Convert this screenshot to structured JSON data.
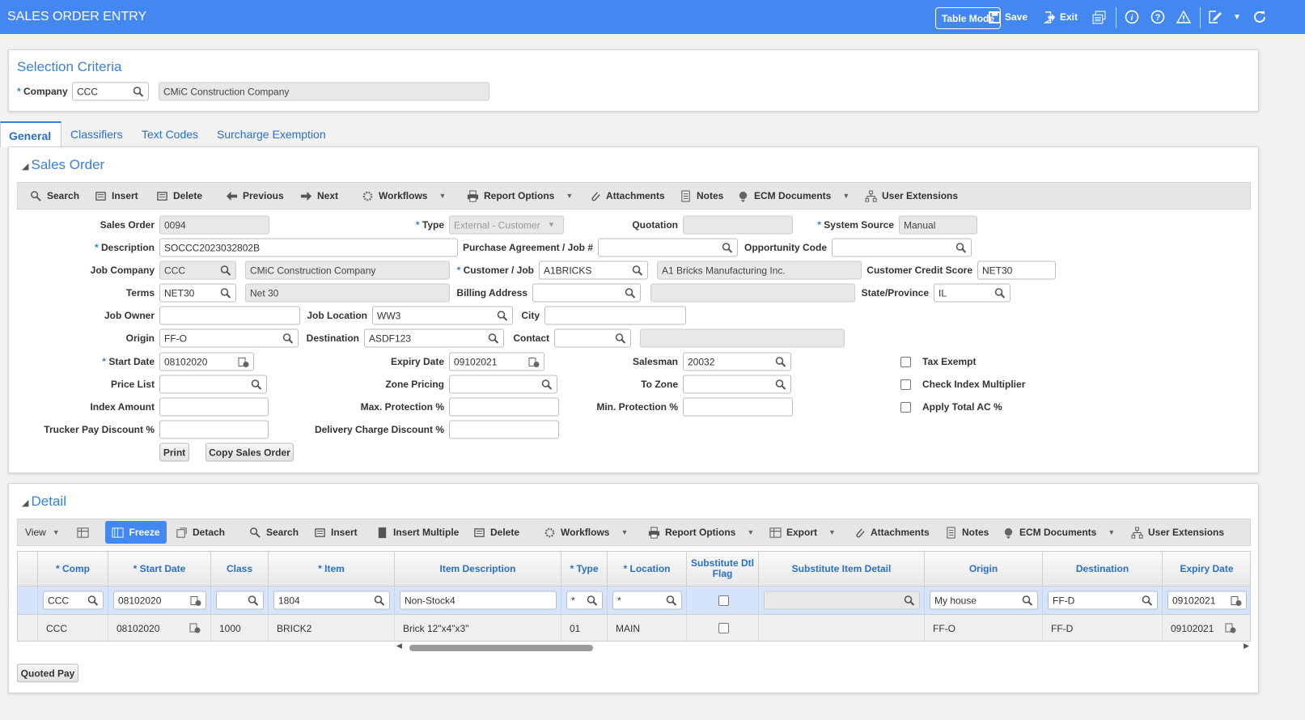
{
  "header": {
    "title": "SALES ORDER ENTRY",
    "table_mode": "Table Mode",
    "save": "Save",
    "exit": "Exit"
  },
  "selection": {
    "title": "Selection Criteria",
    "company_label": "Company",
    "company_value": "CCC",
    "company_name": "CMiC Construction Company"
  },
  "tabs": [
    "General",
    "Classifiers",
    "Text Codes",
    "Surcharge Exemption"
  ],
  "sales_order": {
    "title": "Sales Order",
    "toolbar": [
      "Search",
      "Insert",
      "Delete",
      "Previous",
      "Next",
      "Workflows",
      "Report Options",
      "Attachments",
      "Notes",
      "ECM Documents",
      "User Extensions"
    ],
    "fields": {
      "sales_order": {
        "label": "Sales Order",
        "value": "0094"
      },
      "type": {
        "label": "Type",
        "value": "External - Customer",
        "required": true
      },
      "quotation": {
        "label": "Quotation",
        "value": ""
      },
      "system_source": {
        "label": "System Source",
        "value": "Manual",
        "required": true
      },
      "description": {
        "label": "Description",
        "value": "SOCCC2023032802B",
        "required": true
      },
      "purchase_agreement": {
        "label": "Purchase Agreement / Job #",
        "value": ""
      },
      "opportunity_code": {
        "label": "Opportunity Code",
        "value": ""
      },
      "job_company": {
        "label": "Job Company",
        "value": "CCC",
        "desc": "CMiC Construction Company"
      },
      "customer_job": {
        "label": "Customer / Job",
        "value": "A1BRICKS",
        "desc": "A1 Bricks Manufacturing Inc.",
        "required": true
      },
      "customer_credit_score": {
        "label": "Customer Credit Score",
        "value": "NET30"
      },
      "terms": {
        "label": "Terms",
        "value": "NET30",
        "desc": "Net 30"
      },
      "billing_address": {
        "label": "Billing Address",
        "value": "",
        "desc": ""
      },
      "state_province": {
        "label": "State/Province",
        "value": "IL"
      },
      "job_owner": {
        "label": "Job Owner",
        "value": ""
      },
      "job_location": {
        "label": "Job Location",
        "value": "WW3"
      },
      "city": {
        "label": "City",
        "value": ""
      },
      "origin": {
        "label": "Origin",
        "value": "FF-O"
      },
      "destination": {
        "label": "Destination",
        "value": "ASDF123"
      },
      "contact": {
        "label": "Contact",
        "value": "",
        "desc": ""
      },
      "start_date": {
        "label": "Start Date",
        "value": "08102020",
        "required": true
      },
      "expiry_date": {
        "label": "Expiry Date",
        "value": "09102021"
      },
      "salesman": {
        "label": "Salesman",
        "value": "20032"
      },
      "price_list": {
        "label": "Price List",
        "value": ""
      },
      "zone_pricing": {
        "label": "Zone Pricing",
        "value": ""
      },
      "to_zone": {
        "label": "To Zone",
        "value": ""
      },
      "index_amount": {
        "label": "Index Amount",
        "value": ""
      },
      "max_protection": {
        "label": "Max. Protection %",
        "value": ""
      },
      "min_protection": {
        "label": "Min. Protection %",
        "value": ""
      },
      "trucker_pay_discount": {
        "label": "Trucker Pay Discount %",
        "value": ""
      },
      "delivery_charge_discount": {
        "label": "Delivery Charge Discount %",
        "value": ""
      }
    },
    "checkboxes": [
      {
        "label": "Tax Exempt",
        "checked": false
      },
      {
        "label": "Check Index Multiplier",
        "checked": false
      },
      {
        "label": "Apply Total AC %",
        "checked": false
      }
    ],
    "buttons": {
      "print": "Print",
      "copy": "Copy Sales Order"
    }
  },
  "detail": {
    "title": "Detail",
    "view": "View",
    "toolbar": [
      "Freeze",
      "Detach",
      "Search",
      "Insert",
      "Insert Multiple",
      "Delete",
      "Workflows",
      "Report Options",
      "Export",
      "Attachments",
      "Notes",
      "ECM Documents",
      "User Extensions"
    ],
    "columns": [
      "* Comp",
      "* Start Date",
      "Class",
      "* Item",
      "Item Description",
      "* Type",
      "* Location",
      "Substitute Dtl Flag",
      "Substitute Item Detail",
      "Origin",
      "Destination",
      "Expiry Date"
    ],
    "filter": [
      "CCC",
      "08102020",
      "",
      "1804",
      "Non-Stock4",
      "*",
      "*",
      "",
      "",
      "My house",
      "FF-D",
      "09102021"
    ],
    "rows": [
      [
        "CCC",
        "08102020",
        "1000",
        "BRICK2",
        "Brick 12\"x4\"x3\"",
        "01",
        "MAIN",
        "",
        "",
        "FF-O",
        "FF-D",
        "09102021"
      ]
    ],
    "quoted_pay": "Quoted Pay"
  },
  "colors": {
    "header": "#4388f0",
    "accent": "#3a7fd8"
  }
}
